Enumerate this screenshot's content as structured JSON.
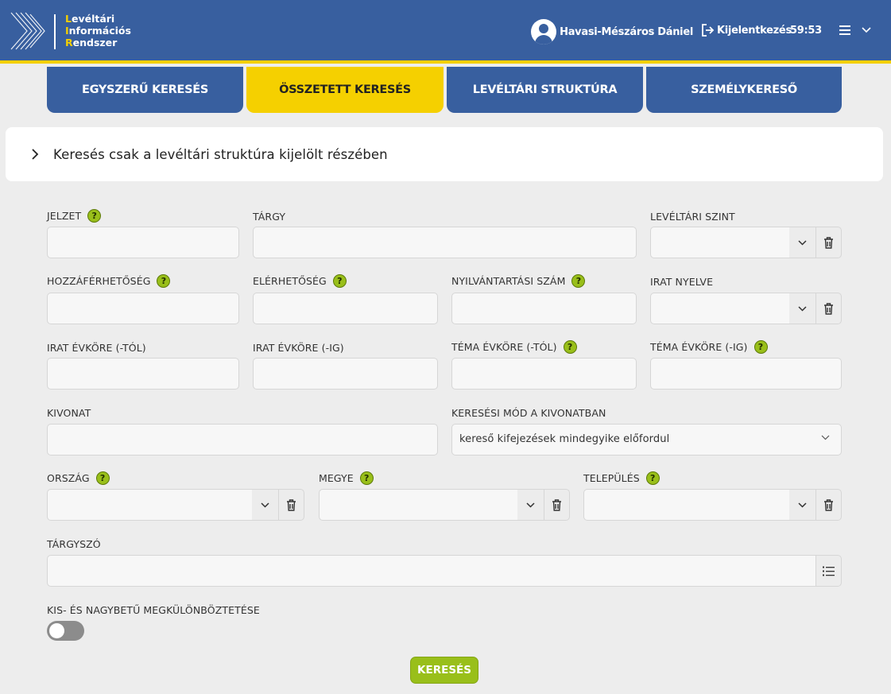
{
  "header": {
    "logo_lines": [
      "Levéltári",
      "Információs",
      "Rendszer"
    ],
    "user_name": "Havasi-Mészáros Dániel",
    "logout_label": "Kijelentkezés",
    "timer": "59:53"
  },
  "tabs": [
    {
      "label": "EGYSZERŰ KERESÉS"
    },
    {
      "label": "ÖSSZETETT KERESÉS"
    },
    {
      "label": "LEVÉLTÁRI STRUKTÚRA"
    },
    {
      "label": "SZEMÉLYKERESŐ"
    }
  ],
  "panel": {
    "label": "Keresés csak a levéltári struktúra kijelölt részében"
  },
  "fields": {
    "jelzet": "JELZET",
    "targy": "TÁRGY",
    "leveltari_szint": "LEVÉLTÁRI SZINT",
    "hozzaferhetoseg": "HOZZÁFÉRHETŐSÉG",
    "elerhetoseg": "ELÉRHETŐSÉG",
    "nyilvantartasi_szam": "NYILVÁNTARTÁSI SZÁM",
    "irat_nyelve": "IRAT NYELVE",
    "irat_evkore_tol": "IRAT ÉVKÖRE (-TÓL)",
    "irat_evkore_ig": "IRAT ÉVKÖRE (-IG)",
    "tema_evkore_tol": "TÉMA ÉVKÖRE (-TÓL)",
    "tema_evkore_ig": "TÉMA ÉVKÖRE (-IG)",
    "kivonat": "KIVONAT",
    "keresesi_mod": "KERESÉSI MÓD A KIVONATBAN",
    "keresesi_mod_value": "kereső kifejezések mindegyike előfordul",
    "orszag": "ORSZÁG",
    "megye": "MEGYE",
    "telepules": "TELEPÜLÉS",
    "targyszo": "TÁRGYSZÓ",
    "kis_nagy": "KIS- ÉS NAGYBETŰ MEGKÜLÖNBÖZTETÉSE"
  },
  "help_glyph": "?",
  "search_button": "KERESÉS",
  "colors": {
    "header_blue": "#385f9f",
    "accent_yellow": "#f5d000",
    "button_green": "#99bf1a"
  }
}
